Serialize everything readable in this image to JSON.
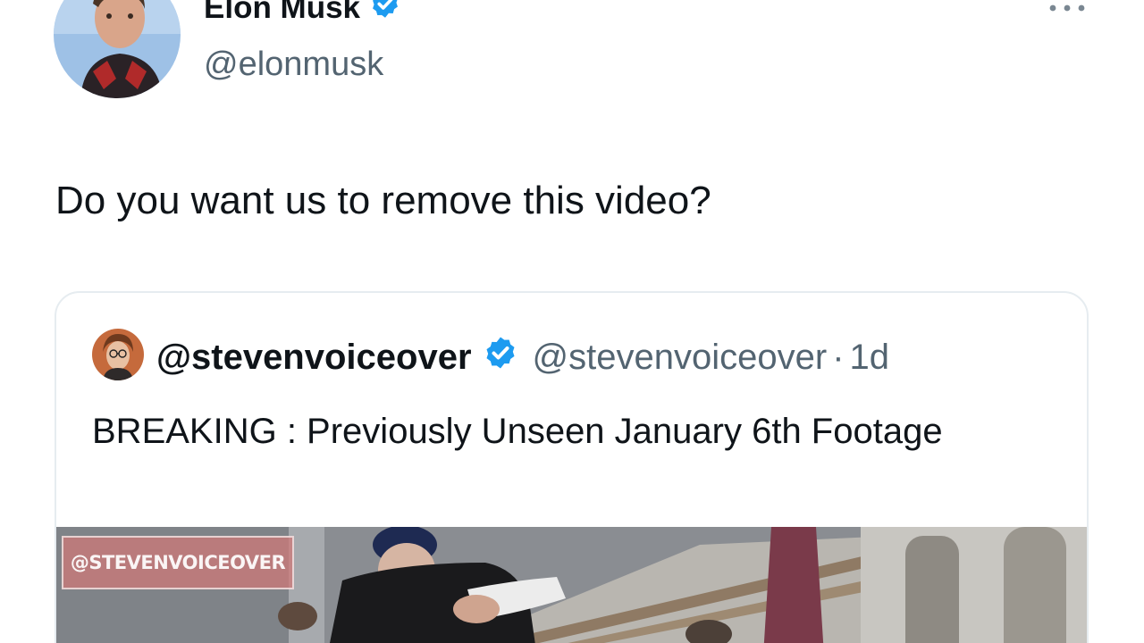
{
  "tweet": {
    "author": {
      "name": "Elon Musk",
      "handle": "@elonmusk",
      "verified": true,
      "avatar_icon": "profile-photo"
    },
    "more_icon": "more-options-icon",
    "text": "Do you want us to remove this video?"
  },
  "quoted_tweet": {
    "author": {
      "name": "@stevenvoiceover",
      "handle": "@stevenvoiceover",
      "verified": true
    },
    "separator": "·",
    "time": "1d",
    "text": "BREAKING : Previously Unseen January 6th Footage",
    "media": {
      "watermark": "@STEVENVOICEOVER"
    }
  },
  "colors": {
    "text": "#0f1419",
    "secondary": "#536471",
    "verified": "#1d9bf0",
    "border": "#e6ecf0"
  }
}
